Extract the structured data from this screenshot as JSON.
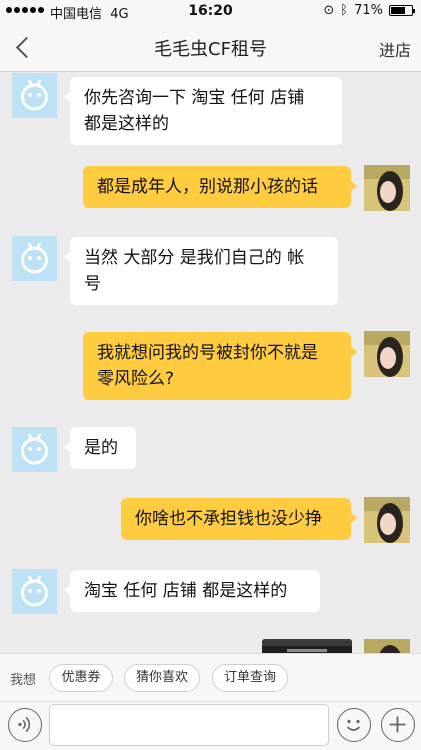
{
  "status_bar": {
    "carrier": "中国电信",
    "network": "4G",
    "time": "16:20",
    "battery": "71%",
    "battery_level": 0.71
  },
  "nav": {
    "title": "毛毛虫CF租号",
    "shop_label": "进店"
  },
  "messages": [
    {
      "side": "left",
      "text": "你先咨询一下  淘宝  任何 店铺\n都是这样的"
    },
    {
      "side": "right",
      "text": "都是成年人，别说那小孩的话"
    },
    {
      "side": "left",
      "text": "当然 大部分  是我们自己的 帐\n号"
    },
    {
      "side": "right",
      "text": "我就想问我的号被封你不就是\n零风险么?"
    },
    {
      "side": "left",
      "text": "是的"
    },
    {
      "side": "right",
      "text": "你啥也不承担钱也没少挣"
    },
    {
      "side": "left",
      "text": "淘宝 任何 店铺 都是这样的"
    }
  ],
  "quick_bar": {
    "label": "我想",
    "chips": [
      "优惠券",
      "猜你喜欢",
      "订单查询"
    ]
  },
  "input": {
    "placeholder": ""
  },
  "icons": {
    "back": "chevron-left-icon",
    "voice": "voice-icon",
    "emoji": "emoji-icon",
    "add": "plus-icon"
  },
  "colors": {
    "bubble_self": "#ffcc40",
    "bubble_other": "#ffffff",
    "chat_background": "#ebebeb",
    "bot_avatar": "#bde1f5"
  }
}
